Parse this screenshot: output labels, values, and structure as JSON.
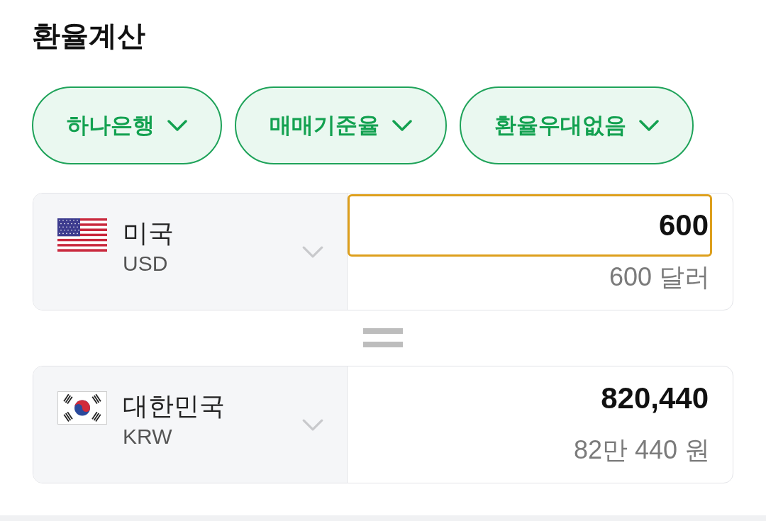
{
  "title": "환율계산",
  "filters": [
    {
      "label": "하나은행"
    },
    {
      "label": "매매기준율"
    },
    {
      "label": "환율우대없음"
    }
  ],
  "converters": [
    {
      "kind": "us",
      "country": "미국",
      "currency": "USD",
      "amount": "600",
      "amount_in_words": "600 달러",
      "focused": true
    },
    {
      "kind": "kr",
      "country": "대한민국",
      "currency": "KRW",
      "amount": "820,440",
      "amount_in_words": "82만 440 원",
      "focused": false
    }
  ]
}
